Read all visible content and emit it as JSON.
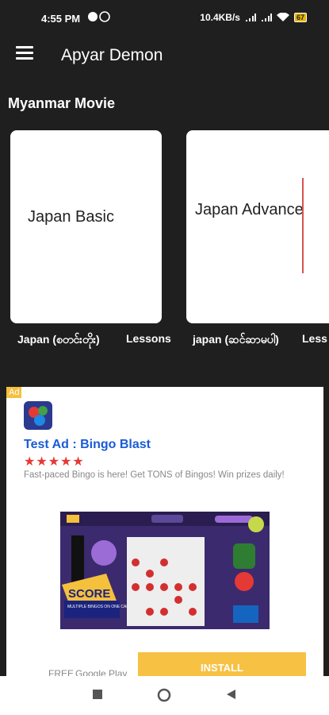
{
  "status": {
    "time": "4:55 PM",
    "net_speed": "10.4KB/s",
    "battery": "67"
  },
  "app": {
    "title": "Apyar Demon"
  },
  "section": {
    "title": "Myanmar Movie"
  },
  "cards": [
    {
      "image_text": "Japan Basic",
      "label": "Japan (စတင်းတိုး)",
      "suffix": "Lessons"
    },
    {
      "image_text": "Japan Advance",
      "label": "japan (ဆင်ဆာမပါ)",
      "suffix": "Less"
    }
  ],
  "ad": {
    "badge": "Ad",
    "title": "Test Ad : Bingo Blast",
    "stars": "★★★★★",
    "description": "Fast-paced Bingo is here! Get TONS of Bingos! Win prizes daily!",
    "free": "FREE",
    "store": "Google Play",
    "install": "INSTALL",
    "banner_score": "SCORE",
    "banner_tag": "MULTIPLE BINGOS ON ONE CARD!"
  },
  "colors": {
    "background": "#1f1f1f",
    "ad_link": "#1a5bd6",
    "install": "#f7c144",
    "stars": "#e53935"
  }
}
